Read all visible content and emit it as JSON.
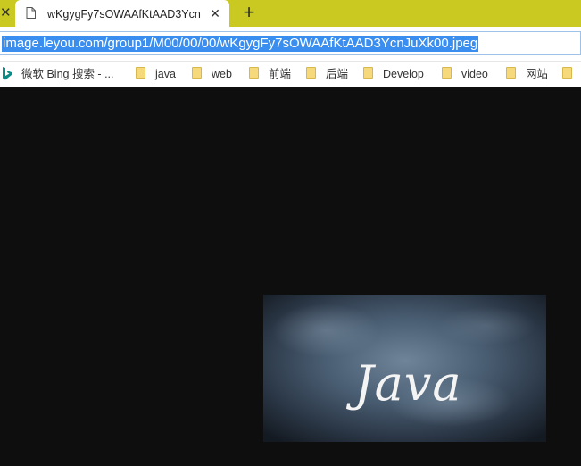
{
  "tab": {
    "title": "wKgygFy7sOWAAfKtAAD3Ycn"
  },
  "address_bar": {
    "url": "image.leyou.com/group1/M00/00/00/wKgygFy7sOWAAfKtAAD3YcnJuXk00.jpeg"
  },
  "bookmarks": [
    {
      "label": "微软 Bing 搜索 - ...",
      "icon": "bing-icon"
    },
    {
      "label": "java",
      "icon": "folder-icon"
    },
    {
      "label": "web",
      "icon": "folder-icon"
    },
    {
      "label": "前端",
      "icon": "folder-icon"
    },
    {
      "label": "后端",
      "icon": "folder-icon"
    },
    {
      "label": "Develop",
      "icon": "folder-icon"
    },
    {
      "label": "video",
      "icon": "folder-icon"
    },
    {
      "label": "网站",
      "icon": "folder-icon"
    }
  ],
  "image": {
    "text": "Java"
  },
  "colors": {
    "tabstrip": "#c9c922",
    "url_highlight": "#3a8ef0",
    "page_background": "#0e0e0e"
  }
}
